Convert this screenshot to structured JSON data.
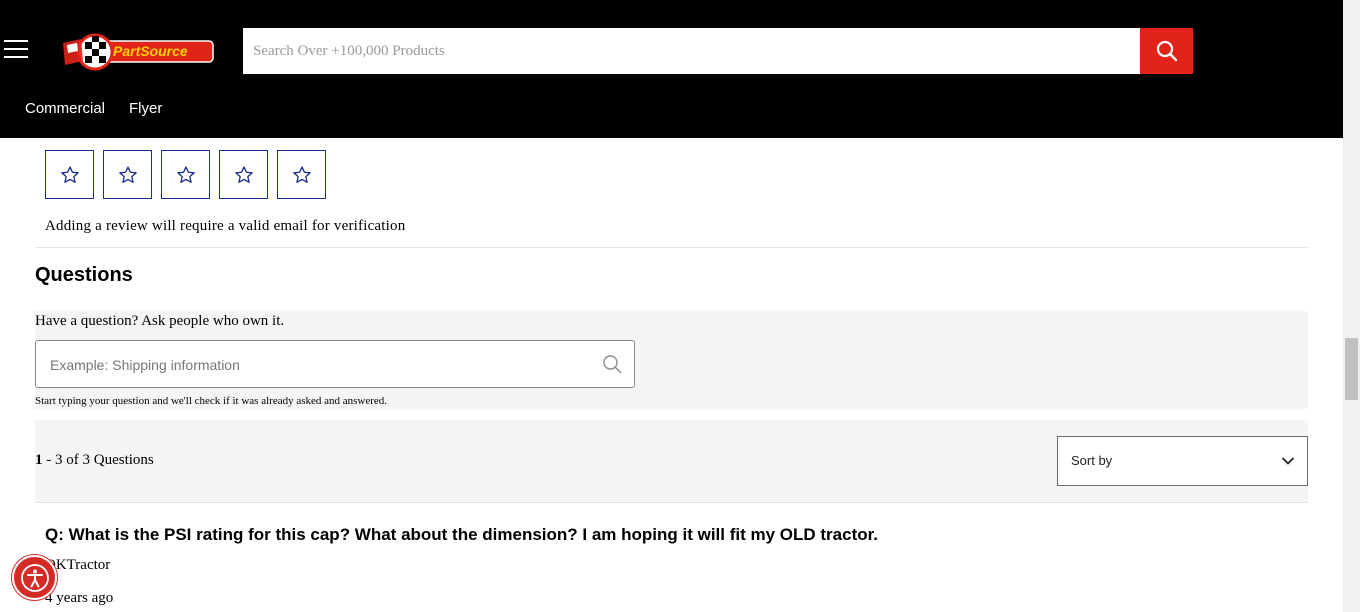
{
  "header": {
    "logo_text": "PartSource",
    "search": {
      "placeholder": "Search Over +100,000 Products",
      "value": ""
    },
    "nav": [
      "Commercial",
      "Flyer"
    ]
  },
  "reviews": {
    "star_count": 5,
    "note": "Adding a review will require a valid email for verification"
  },
  "questions": {
    "title": "Questions",
    "ask_label": "Have a question? Ask people who own it.",
    "ask_placeholder": "Example: Shipping information",
    "hint": "Start typing your question and we'll check if it was already asked and answered.",
    "count_bold": "1",
    "count_rest": " - 3 of 3 Questions",
    "sort_label": "Sort by",
    "items": [
      {
        "question": "Q: What is the PSI rating for this cap?  What about the dimension?  I am hoping it will fit my OLD tractor.",
        "author": "OKTractor",
        "date": "4 years ago"
      }
    ]
  },
  "colors": {
    "header_bg": "#000000",
    "accent_red": "#e2231a",
    "star_border": "#1a2e8f"
  },
  "icons": [
    "menu-icon",
    "search-icon",
    "star-icon",
    "chevron-down-icon",
    "accessibility-icon"
  ]
}
